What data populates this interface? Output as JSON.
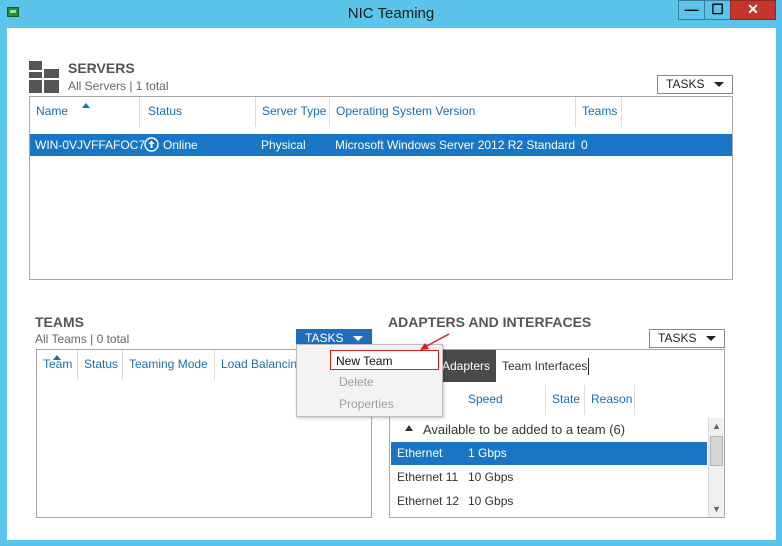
{
  "window": {
    "title": "NIC Teaming",
    "minimize": "—",
    "maximize": "☐",
    "close": "✕"
  },
  "servers": {
    "title": "SERVERS",
    "subtitle": "All Servers | 1 total",
    "tasks_label": "TASKS",
    "columns": [
      "Name",
      "Status",
      "Server Type",
      "Operating System Version",
      "Teams"
    ],
    "rows": [
      {
        "name": "WIN-0VJVFFAFOC7",
        "status": "Online",
        "server_type": "Physical",
        "os": "Microsoft Windows Server 2012 R2 Standard",
        "teams": "0"
      }
    ]
  },
  "teams": {
    "title": "TEAMS",
    "subtitle": "All Teams | 0 total",
    "tasks_label": "TASKS",
    "columns": [
      "Team",
      "Status",
      "Teaming Mode",
      "Load Balancing"
    ],
    "menu": [
      "New Team",
      "Delete",
      "Properties"
    ]
  },
  "adapters": {
    "title": "ADAPTERS AND INTERFACES",
    "tasks_label": "TASKS",
    "tabs": [
      "Adapters",
      "Team Interfaces"
    ],
    "columns": [
      "Speed",
      "State",
      "Reason"
    ],
    "group_label": "Available to be added to a team (6)",
    "rows": [
      {
        "name": "Ethernet",
        "speed": "1 Gbps"
      },
      {
        "name": "Ethernet 11",
        "speed": "10 Gbps"
      },
      {
        "name": "Ethernet 12",
        "speed": "10 Gbps"
      }
    ]
  },
  "colors": {
    "window_frame": "#5bc4ea",
    "selection": "#1976c4",
    "header_link": "#1a6fae",
    "close_button": "#c7352a"
  }
}
